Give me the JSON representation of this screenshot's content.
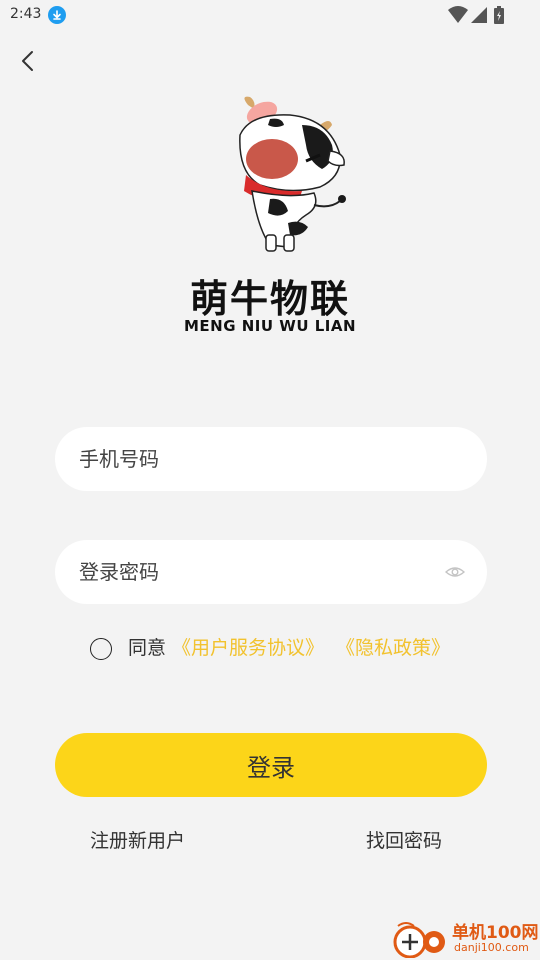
{
  "status_bar": {
    "time": "2:43",
    "icons": [
      "download-icon",
      "wifi-icon",
      "signal-icon",
      "battery-icon"
    ]
  },
  "nav": {
    "back_icon": "chevron-left-icon"
  },
  "logo": {
    "name_cn": "萌牛物联",
    "name_en": "MENG NIU WU LIAN"
  },
  "form": {
    "phone_placeholder": "手机号码",
    "password_placeholder": "登录密码",
    "password_toggle_icon": "eye-icon"
  },
  "agreement": {
    "prefix": "同意",
    "terms_link": "《用户服务协议》",
    "privacy_link": "《隐私政策》",
    "checked": false
  },
  "actions": {
    "login_label": "登录",
    "register_label": "注册新用户",
    "forgot_label": "找回密码"
  },
  "watermark": {
    "title": "单机100网",
    "url": "danji100.com"
  },
  "colors": {
    "background": "#f3f3f3",
    "primary": "#fcd519",
    "link": "#f2c22e",
    "field": "#ffffff",
    "download_badge": "#1e9df0"
  }
}
